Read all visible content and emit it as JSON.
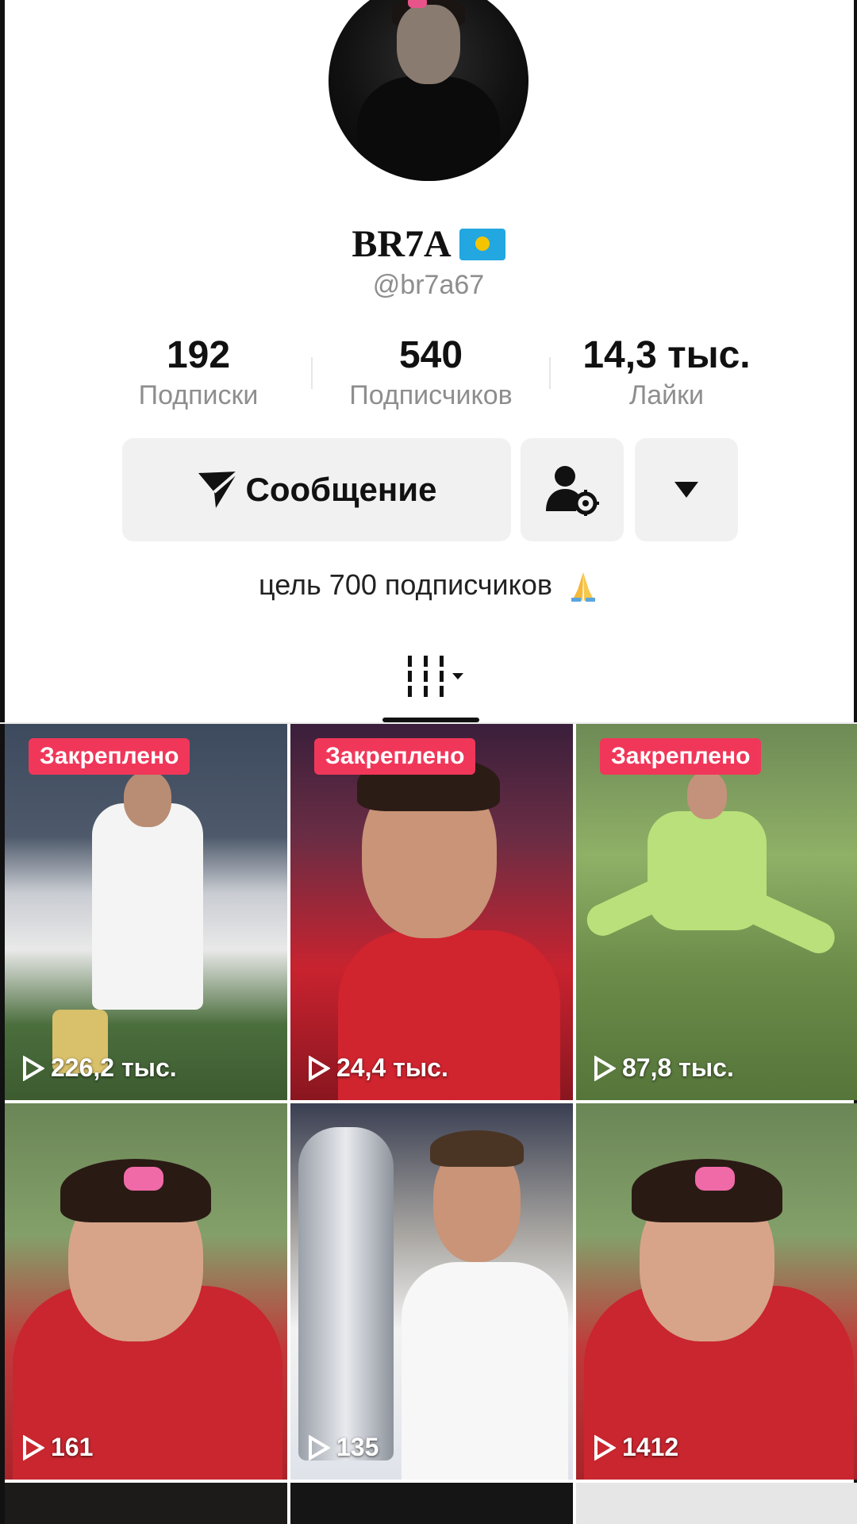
{
  "profile": {
    "display_name": "BR7A",
    "handle": "@br7a67",
    "flag": "kz-flag"
  },
  "stats": [
    {
      "value": "192",
      "label": "Подписки"
    },
    {
      "value": "540",
      "label": "Подписчиков"
    },
    {
      "value": "14,3 тыс.",
      "label": "Лайки"
    }
  ],
  "actions": {
    "message_label": "Сообщение",
    "message_icon": "send-icon",
    "friends_icon": "user-settings-icon",
    "more_icon": "triangle-down-icon"
  },
  "bio": {
    "text": "цель 700 подписчиков",
    "emoji": "folded-hands"
  },
  "tabs": {
    "active_icon": "grid-filter-icon"
  },
  "videos": [
    {
      "badge": "Закреплено",
      "views": "226,2 тыс."
    },
    {
      "badge": "Закреплено",
      "views": "24,4 тыс."
    },
    {
      "badge": "Закреплено",
      "views": "87,8 тыс."
    },
    {
      "views": "161"
    },
    {
      "views": "135"
    },
    {
      "views": "1412"
    }
  ],
  "colors": {
    "pinned_badge": "#f0375a",
    "button_bg": "#f1f1f2",
    "muted_text": "#8e8e8e"
  }
}
